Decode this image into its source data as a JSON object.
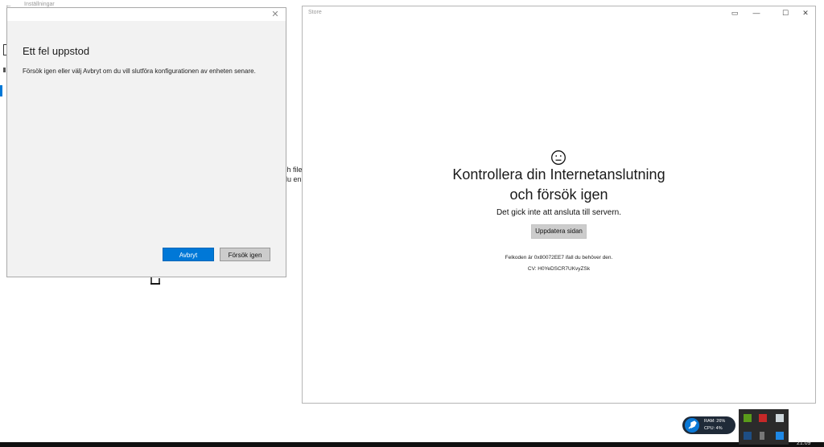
{
  "background_window": {
    "back_glyph": "←",
    "title": "Inställningar",
    "fragment_1": "ch filer",
    "fragment_2": "du enk"
  },
  "dialog": {
    "close_glyph": "✕",
    "heading": "Ett fel uppstod",
    "message": "Försök igen eller välj Avbryt om du vill slutföra konfigurationen av enheten senare.",
    "cancel_label": "Avbryt",
    "retry_label": "Försök igen"
  },
  "store": {
    "title": "Store",
    "controls": {
      "mini_glyph": "▭",
      "minimize_glyph": "—",
      "maximize_glyph": "☐",
      "close_glyph": "✕"
    },
    "heading_line_1": "Kontrollera din Internetanslutning",
    "heading_line_2": "och försök igen",
    "subtitle": "Det gick inte att ansluta till servern.",
    "refresh_label": "Uppdatera sidan",
    "error_code_text": "Felkoden är 0x80072EE7 ifall du behöver den.",
    "cv_text": "CV: H0YeDSCR7UKvyZSk"
  },
  "tray": {
    "ram_text": "RAM: 26%",
    "cpu_text": "CPU: 4%",
    "clock_fragment": "21:09"
  },
  "colors": {
    "accent": "#0078d7",
    "dialog_bg": "#f2f2f2",
    "button_gray": "#cccccc"
  }
}
